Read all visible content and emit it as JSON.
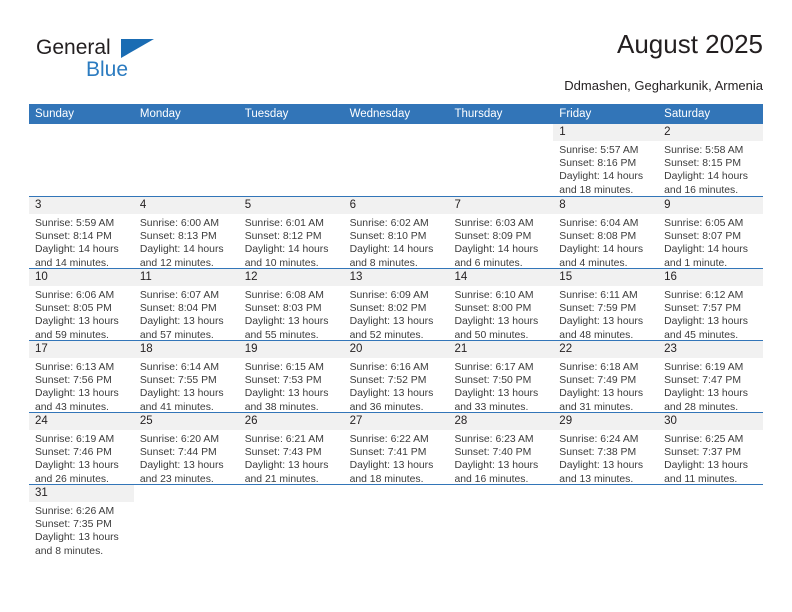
{
  "logo": {
    "word_one": "General",
    "word_two": "Blue",
    "flag_icon": "blue-triangle-flag",
    "accent_color": "#2b7bc0"
  },
  "header": {
    "title": "August 2025",
    "subtitle": "Ddmashen, Gegharkunik, Armenia"
  },
  "theme": {
    "header_blue": "#3275b8",
    "daynum_band": "#f1f1f1",
    "text": "#231f20"
  },
  "weekdays": [
    "Sunday",
    "Monday",
    "Tuesday",
    "Wednesday",
    "Thursday",
    "Friday",
    "Saturday"
  ],
  "weeks": [
    [
      {
        "empty": true
      },
      {
        "empty": true
      },
      {
        "empty": true
      },
      {
        "empty": true
      },
      {
        "empty": true
      },
      {
        "day": "1",
        "sunrise": "Sunrise: 5:57 AM",
        "sunset": "Sunset: 8:16 PM",
        "daylight_line1": "Daylight: 14 hours",
        "daylight_line2": "and 18 minutes."
      },
      {
        "day": "2",
        "sunrise": "Sunrise: 5:58 AM",
        "sunset": "Sunset: 8:15 PM",
        "daylight_line1": "Daylight: 14 hours",
        "daylight_line2": "and 16 minutes."
      }
    ],
    [
      {
        "day": "3",
        "sunrise": "Sunrise: 5:59 AM",
        "sunset": "Sunset: 8:14 PM",
        "daylight_line1": "Daylight: 14 hours",
        "daylight_line2": "and 14 minutes."
      },
      {
        "day": "4",
        "sunrise": "Sunrise: 6:00 AM",
        "sunset": "Sunset: 8:13 PM",
        "daylight_line1": "Daylight: 14 hours",
        "daylight_line2": "and 12 minutes."
      },
      {
        "day": "5",
        "sunrise": "Sunrise: 6:01 AM",
        "sunset": "Sunset: 8:12 PM",
        "daylight_line1": "Daylight: 14 hours",
        "daylight_line2": "and 10 minutes."
      },
      {
        "day": "6",
        "sunrise": "Sunrise: 6:02 AM",
        "sunset": "Sunset: 8:10 PM",
        "daylight_line1": "Daylight: 14 hours",
        "daylight_line2": "and 8 minutes."
      },
      {
        "day": "7",
        "sunrise": "Sunrise: 6:03 AM",
        "sunset": "Sunset: 8:09 PM",
        "daylight_line1": "Daylight: 14 hours",
        "daylight_line2": "and 6 minutes."
      },
      {
        "day": "8",
        "sunrise": "Sunrise: 6:04 AM",
        "sunset": "Sunset: 8:08 PM",
        "daylight_line1": "Daylight: 14 hours",
        "daylight_line2": "and 4 minutes."
      },
      {
        "day": "9",
        "sunrise": "Sunrise: 6:05 AM",
        "sunset": "Sunset: 8:07 PM",
        "daylight_line1": "Daylight: 14 hours",
        "daylight_line2": "and 1 minute."
      }
    ],
    [
      {
        "day": "10",
        "sunrise": "Sunrise: 6:06 AM",
        "sunset": "Sunset: 8:05 PM",
        "daylight_line1": "Daylight: 13 hours",
        "daylight_line2": "and 59 minutes."
      },
      {
        "day": "11",
        "sunrise": "Sunrise: 6:07 AM",
        "sunset": "Sunset: 8:04 PM",
        "daylight_line1": "Daylight: 13 hours",
        "daylight_line2": "and 57 minutes."
      },
      {
        "day": "12",
        "sunrise": "Sunrise: 6:08 AM",
        "sunset": "Sunset: 8:03 PM",
        "daylight_line1": "Daylight: 13 hours",
        "daylight_line2": "and 55 minutes."
      },
      {
        "day": "13",
        "sunrise": "Sunrise: 6:09 AM",
        "sunset": "Sunset: 8:02 PM",
        "daylight_line1": "Daylight: 13 hours",
        "daylight_line2": "and 52 minutes."
      },
      {
        "day": "14",
        "sunrise": "Sunrise: 6:10 AM",
        "sunset": "Sunset: 8:00 PM",
        "daylight_line1": "Daylight: 13 hours",
        "daylight_line2": "and 50 minutes."
      },
      {
        "day": "15",
        "sunrise": "Sunrise: 6:11 AM",
        "sunset": "Sunset: 7:59 PM",
        "daylight_line1": "Daylight: 13 hours",
        "daylight_line2": "and 48 minutes."
      },
      {
        "day": "16",
        "sunrise": "Sunrise: 6:12 AM",
        "sunset": "Sunset: 7:57 PM",
        "daylight_line1": "Daylight: 13 hours",
        "daylight_line2": "and 45 minutes."
      }
    ],
    [
      {
        "day": "17",
        "sunrise": "Sunrise: 6:13 AM",
        "sunset": "Sunset: 7:56 PM",
        "daylight_line1": "Daylight: 13 hours",
        "daylight_line2": "and 43 minutes."
      },
      {
        "day": "18",
        "sunrise": "Sunrise: 6:14 AM",
        "sunset": "Sunset: 7:55 PM",
        "daylight_line1": "Daylight: 13 hours",
        "daylight_line2": "and 41 minutes."
      },
      {
        "day": "19",
        "sunrise": "Sunrise: 6:15 AM",
        "sunset": "Sunset: 7:53 PM",
        "daylight_line1": "Daylight: 13 hours",
        "daylight_line2": "and 38 minutes."
      },
      {
        "day": "20",
        "sunrise": "Sunrise: 6:16 AM",
        "sunset": "Sunset: 7:52 PM",
        "daylight_line1": "Daylight: 13 hours",
        "daylight_line2": "and 36 minutes."
      },
      {
        "day": "21",
        "sunrise": "Sunrise: 6:17 AM",
        "sunset": "Sunset: 7:50 PM",
        "daylight_line1": "Daylight: 13 hours",
        "daylight_line2": "and 33 minutes."
      },
      {
        "day": "22",
        "sunrise": "Sunrise: 6:18 AM",
        "sunset": "Sunset: 7:49 PM",
        "daylight_line1": "Daylight: 13 hours",
        "daylight_line2": "and 31 minutes."
      },
      {
        "day": "23",
        "sunrise": "Sunrise: 6:19 AM",
        "sunset": "Sunset: 7:47 PM",
        "daylight_line1": "Daylight: 13 hours",
        "daylight_line2": "and 28 minutes."
      }
    ],
    [
      {
        "day": "24",
        "sunrise": "Sunrise: 6:19 AM",
        "sunset": "Sunset: 7:46 PM",
        "daylight_line1": "Daylight: 13 hours",
        "daylight_line2": "and 26 minutes."
      },
      {
        "day": "25",
        "sunrise": "Sunrise: 6:20 AM",
        "sunset": "Sunset: 7:44 PM",
        "daylight_line1": "Daylight: 13 hours",
        "daylight_line2": "and 23 minutes."
      },
      {
        "day": "26",
        "sunrise": "Sunrise: 6:21 AM",
        "sunset": "Sunset: 7:43 PM",
        "daylight_line1": "Daylight: 13 hours",
        "daylight_line2": "and 21 minutes."
      },
      {
        "day": "27",
        "sunrise": "Sunrise: 6:22 AM",
        "sunset": "Sunset: 7:41 PM",
        "daylight_line1": "Daylight: 13 hours",
        "daylight_line2": "and 18 minutes."
      },
      {
        "day": "28",
        "sunrise": "Sunrise: 6:23 AM",
        "sunset": "Sunset: 7:40 PM",
        "daylight_line1": "Daylight: 13 hours",
        "daylight_line2": "and 16 minutes."
      },
      {
        "day": "29",
        "sunrise": "Sunrise: 6:24 AM",
        "sunset": "Sunset: 7:38 PM",
        "daylight_line1": "Daylight: 13 hours",
        "daylight_line2": "and 13 minutes."
      },
      {
        "day": "30",
        "sunrise": "Sunrise: 6:25 AM",
        "sunset": "Sunset: 7:37 PM",
        "daylight_line1": "Daylight: 13 hours",
        "daylight_line2": "and 11 minutes."
      }
    ],
    [
      {
        "day": "31",
        "sunrise": "Sunrise: 6:26 AM",
        "sunset": "Sunset: 7:35 PM",
        "daylight_line1": "Daylight: 13 hours",
        "daylight_line2": "and 8 minutes."
      },
      {
        "empty": true
      },
      {
        "empty": true
      },
      {
        "empty": true
      },
      {
        "empty": true
      },
      {
        "empty": true
      },
      {
        "empty": true
      }
    ]
  ]
}
